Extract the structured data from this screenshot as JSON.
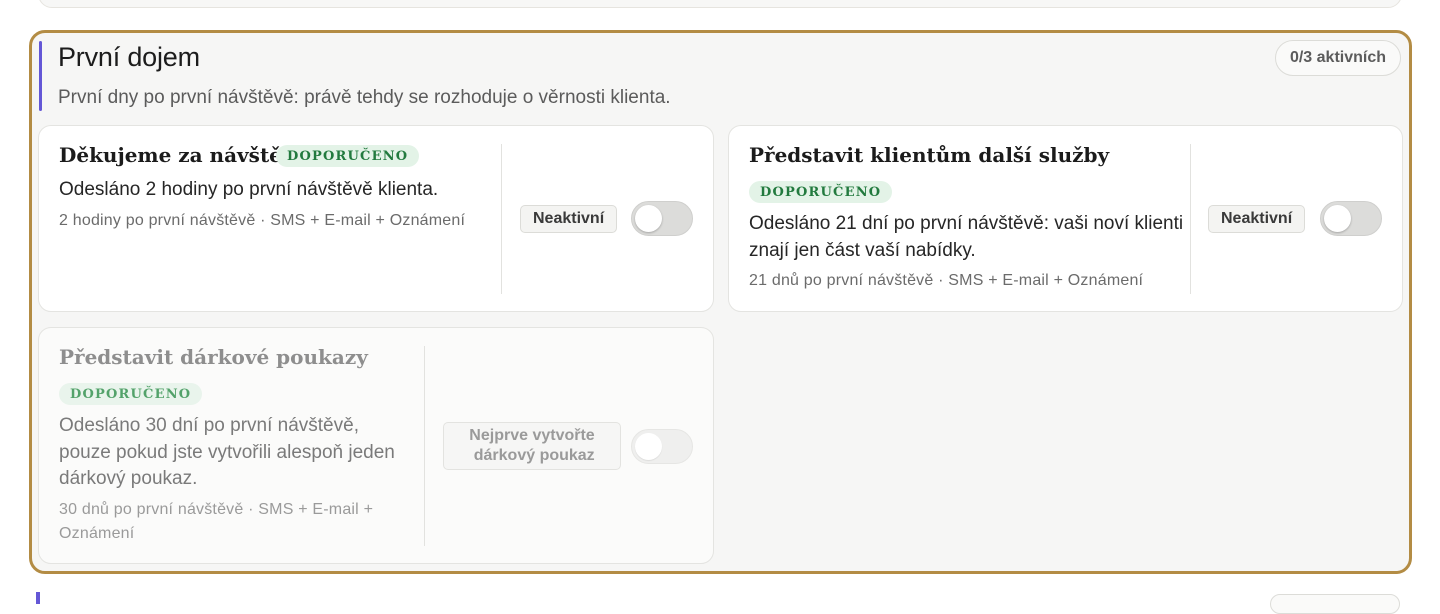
{
  "section": {
    "title": "První dojem",
    "subtitle": "První dny po první návštěvě: právě tehdy se rozhoduje o věrnosti klienta.",
    "active_count": "0/3 aktivních",
    "accent_color": "#6457d6",
    "border_color": "#b38c44"
  },
  "cards": [
    {
      "title": "Děkujeme za návštěvu!",
      "badge": "DOPORUČENO",
      "description": "Odesláno 2 hodiny po první návštěvě klienta.",
      "meta": "2 hodiny po první návštěvě · SMS + E-mail + Oznámení",
      "status": "Neaktivní",
      "enabled": false
    },
    {
      "title": "Představit klientům další služby",
      "badge": "DOPORUČENO",
      "description_line1": "Odesláno 21 dní po první návštěvě: vaši noví klienti",
      "description_line2": "znají jen část vaší nabídky.",
      "meta": "21 dnů po první návštěvě · SMS + E-mail + Oznámení",
      "status": "Neaktivní",
      "enabled": false
    },
    {
      "title": "Představit dárkové poukazy",
      "badge": "DOPORUČENO",
      "description_line1": "Odesláno 30 dní po první návštěvě,",
      "description_line2": "pouze pokud jste vytvořili alespoň jeden",
      "description_line3": "dárkový poukaz.",
      "meta_line1": "30 dnů po první návštěvě · SMS + E-mail +",
      "meta_line2": "Oznámení",
      "status_line1": "Nejprve vytvořte",
      "status_line2": "dárkový poukaz",
      "enabled": false,
      "disabled": true
    }
  ],
  "colors": {
    "recommended_badge_bg": "#e3f3e7",
    "recommended_badge_text": "#227a3e"
  }
}
